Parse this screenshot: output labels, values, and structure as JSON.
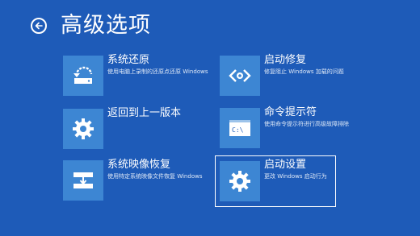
{
  "header": {
    "back_icon": "back-arrow-circle-icon",
    "title": "高级选项"
  },
  "options": [
    {
      "id": "system-restore",
      "name": "系统还原",
      "desc": "使用电脑上录制的还原点还原 Windows",
      "icon": "restore-icon"
    },
    {
      "id": "go-back",
      "name": "返回到上一版本",
      "desc": "",
      "icon": "gear-icon"
    },
    {
      "id": "system-image-recovery",
      "name": "系统映像恢复",
      "desc": "使用特定系统映像文件恢复 Windows",
      "icon": "drive-restore-icon"
    },
    {
      "id": "startup-repair",
      "name": "启动修复",
      "desc": "修复阻止 Windows 加载的问题",
      "icon": "code-brackets-icon"
    },
    {
      "id": "command-prompt",
      "name": "命令提示符",
      "desc": "使用命令提示符进行高级故障排除",
      "icon": "command-prompt-icon"
    },
    {
      "id": "startup-settings",
      "name": "启动设置",
      "desc": "更改 Windows 启动行为",
      "icon": "gear-icon"
    }
  ],
  "colors": {
    "background": "#1e5bb8",
    "tile": "#3d86d3",
    "text": "#ffffff"
  }
}
